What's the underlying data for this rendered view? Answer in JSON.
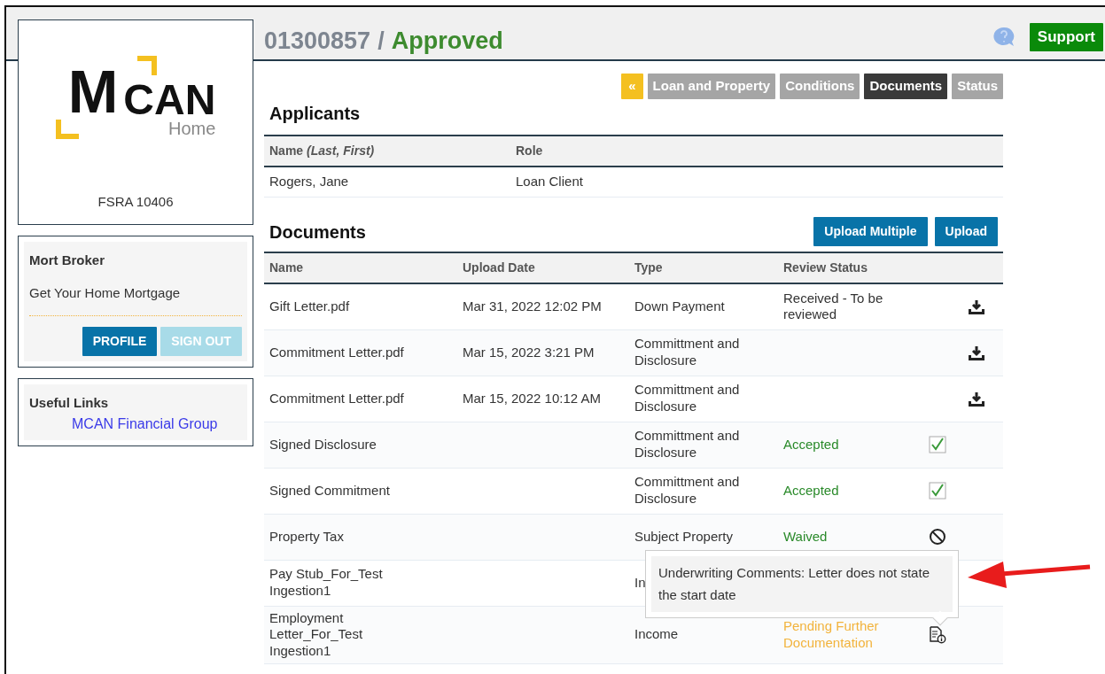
{
  "header": {
    "loan_number": "01300857",
    "separator": "/",
    "loan_status": "Approved",
    "support_button": "Support"
  },
  "logo": {
    "letter": "M",
    "word": "CAN",
    "sub": "Home",
    "license": "FSRA 10406"
  },
  "user_panel": {
    "name": "Mort Broker",
    "tagline": "Get Your Home Mortgage",
    "buttons": [
      {
        "label": "PROFILE",
        "disabled": false
      },
      {
        "label": "SIGN OUT",
        "disabled": true
      }
    ]
  },
  "links_panel": {
    "title": "Useful Links",
    "links": [
      "MCAN Financial Group"
    ]
  },
  "back_button": "«",
  "tabs": [
    {
      "label": "Loan and Property",
      "selected": false
    },
    {
      "label": "Conditions",
      "selected": false
    },
    {
      "label": "Documents",
      "selected": true
    },
    {
      "label": "Status",
      "selected": false
    }
  ],
  "applicants": {
    "title": "Applicants",
    "columns": [
      "Name *(Last, First)*",
      "Role"
    ],
    "rows": [
      [
        "Rogers, Jane",
        "Loan Client"
      ]
    ]
  },
  "documents": {
    "title": "Documents",
    "buttons": [
      "Upload Multiple",
      "Upload"
    ],
    "columns": [
      "Name",
      "Upload Date",
      "Type",
      "Review Status"
    ],
    "rows": [
      {
        "name": "Gift Letter.pdf",
        "date": "Mar 31, 2022 12:02 PM",
        "type": "Down Payment",
        "status": "Received - To be reviewed",
        "kind": "received"
      },
      {
        "name": "Commitment Letter.pdf",
        "date": "Mar 15, 2022 3:21 PM",
        "type": "Committment and Disclosure",
        "kind": "file"
      },
      {
        "name": "Commitment Letter.pdf",
        "date": "Mar 15, 2022 10:12 AM",
        "type": "Committment and Disclosure",
        "kind": "file"
      },
      {
        "name": "Signed Disclosure",
        "type": "Committment and Disclosure",
        "status": "Accepted",
        "kind": "accepted"
      },
      {
        "name": "Signed Commitment",
        "type": "Committment and Disclosure",
        "status": "Accepted",
        "kind": "accepted"
      },
      {
        "name": "Property Tax",
        "type": "Subject Property",
        "status": "Waived",
        "kind": "waived"
      },
      {
        "name": "Pay Stub_For_Test Ingestion1",
        "type": "In",
        "kind": "blank"
      },
      {
        "name": "Employment Letter_For_Test Ingestion1",
        "type": "Income",
        "status": "Pending Further Documentation",
        "kind": "pending"
      }
    ]
  },
  "tooltip": {
    "text": "Underwriting Comments: Letter does not state the start date"
  }
}
